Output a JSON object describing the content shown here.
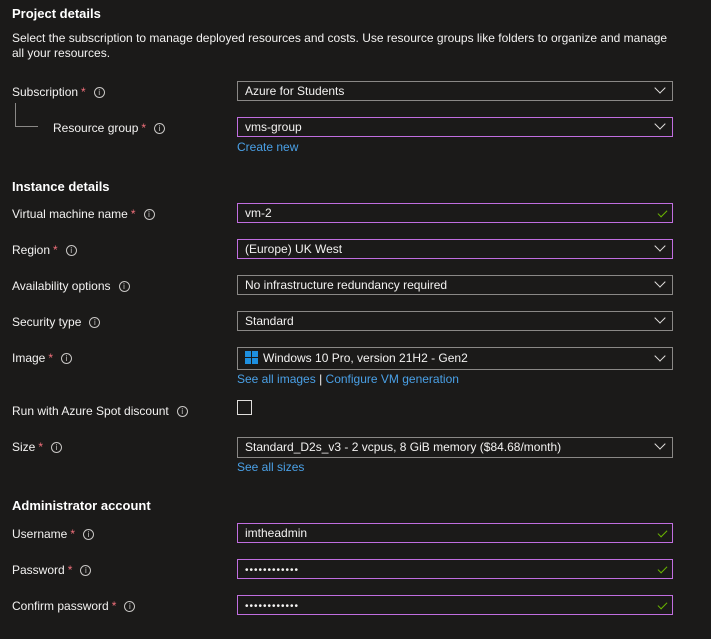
{
  "project": {
    "title": "Project details",
    "description": "Select the subscription to manage deployed resources and costs. Use resource groups like folders to organize and manage all your resources.",
    "subscription": {
      "label": "Subscription",
      "value": "Azure for Students"
    },
    "resource_group": {
      "label": "Resource group",
      "value": "vms-group",
      "create_new": "Create new"
    }
  },
  "instance": {
    "title": "Instance details",
    "vm_name": {
      "label": "Virtual machine name",
      "value": "vm-2"
    },
    "region": {
      "label": "Region",
      "value": "(Europe) UK West"
    },
    "availability": {
      "label": "Availability options",
      "value": "No infrastructure redundancy required"
    },
    "security": {
      "label": "Security type",
      "value": "Standard"
    },
    "image": {
      "label": "Image",
      "value": "Windows 10 Pro, version 21H2 - Gen2",
      "see_all": "See all images",
      "separator": "|",
      "configure": "Configure VM generation"
    },
    "spot": {
      "label": "Run with Azure Spot discount",
      "checked": false
    },
    "size": {
      "label": "Size",
      "value": "Standard_D2s_v3 - 2 vcpus, 8 GiB memory ($84.68/month)",
      "see_all": "See all sizes"
    }
  },
  "admin": {
    "title": "Administrator account",
    "username": {
      "label": "Username",
      "value": "imtheadmin"
    },
    "password": {
      "label": "Password",
      "value": "••••••••••••"
    },
    "confirm": {
      "label": "Confirm password",
      "value": "••••••••••••"
    }
  },
  "symbols": {
    "required": "*",
    "info": "i"
  },
  "colors": {
    "accent_focus": "#c06ee0",
    "link": "#4aa0e6",
    "valid": "#6bb700",
    "required": "#f1707b"
  }
}
